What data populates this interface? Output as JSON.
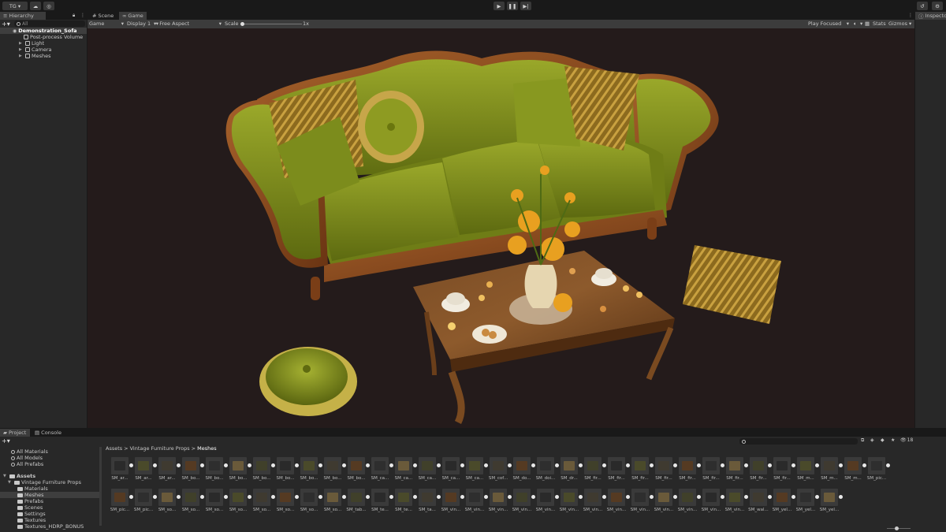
{
  "toolbar": {
    "account_label": "TG",
    "play_icon": "play-icon",
    "pause_icon": "pause-icon",
    "step_icon": "step-icon"
  },
  "hierarchy": {
    "tab_label": "Hierarchy",
    "search_placeholder": "All",
    "scene_name": "Demonstration_Sofa",
    "items": [
      "Post-process Volume",
      "Light",
      "Camera",
      "Meshes"
    ]
  },
  "game_view": {
    "tabs": [
      "Scene",
      "Game"
    ],
    "mode": "Game",
    "display": "Display 1",
    "aspect": "Free Aspect",
    "scale_label": "Scale",
    "scale_value": "1x",
    "play_focused": "Play Focused",
    "stats": "Stats",
    "gizmos": "Gizmos"
  },
  "inspector": {
    "tab_label": "Inspector"
  },
  "project": {
    "tabs": [
      "Project",
      "Console"
    ],
    "search_items": [
      "All Materials",
      "All Models",
      "All Prefabs"
    ],
    "assets_root": "Assets",
    "folders": [
      "Vintage Furniture Props",
      "Materials",
      "Meshes",
      "Prefabs",
      "Scenes",
      "Settings",
      "Textures",
      "Textures_HDRP_BONUS"
    ],
    "breadcrumb": [
      "Assets",
      "Vintage Furniture Props",
      "Meshes"
    ],
    "count_badge": "18",
    "row1": [
      "SM_ar...",
      "SM_ar...",
      "SM_ar...",
      "SM_bo...",
      "SM_bo...",
      "SM_bo...",
      "SM_bo...",
      "SM_bo...",
      "SM_bo...",
      "SM_bo...",
      "SM_bo...",
      "SM_ca...",
      "SM_ca...",
      "SM_ca...",
      "SM_ca...",
      "SM_ca...",
      "SM_cof...",
      "SM_do...",
      "SM_doi...",
      "SM_dr...",
      "SM_fir...",
      "SM_fir...",
      "SM_fir...",
      "SM_fir...",
      "SM_fir...",
      "SM_fir...",
      "SM_fir...",
      "SM_fir...",
      "SM_fir...",
      "SM_m...",
      "SM_m...",
      "SM_m...",
      "SM_pic..."
    ],
    "row2": [
      "SM_pic...",
      "SM_pic...",
      "SM_so...",
      "SM_so...",
      "SM_so...",
      "SM_so...",
      "SM_so...",
      "SM_so...",
      "SM_so...",
      "SM_so...",
      "SM_tab...",
      "SM_te...",
      "SM_te...",
      "SM_ta...",
      "SM_vin...",
      "SM_vin...",
      "SM_vin...",
      "SM_vin...",
      "SM_vin...",
      "SM_vin...",
      "SM_vin...",
      "SM_vin...",
      "SM_vin...",
      "SM_vin...",
      "SM_vin...",
      "SM_vin...",
      "SM_vin...",
      "SM_wal...",
      "SM_yel...",
      "SM_yel...",
      "SM_yel..."
    ]
  },
  "colors": {
    "panel": "#282828",
    "toolbar": "#191919",
    "game_bg": "#241b1b",
    "sofa_green": "#7a8a1c",
    "wood": "#8a4a1e",
    "stripe_gold": "#b08a2c"
  }
}
